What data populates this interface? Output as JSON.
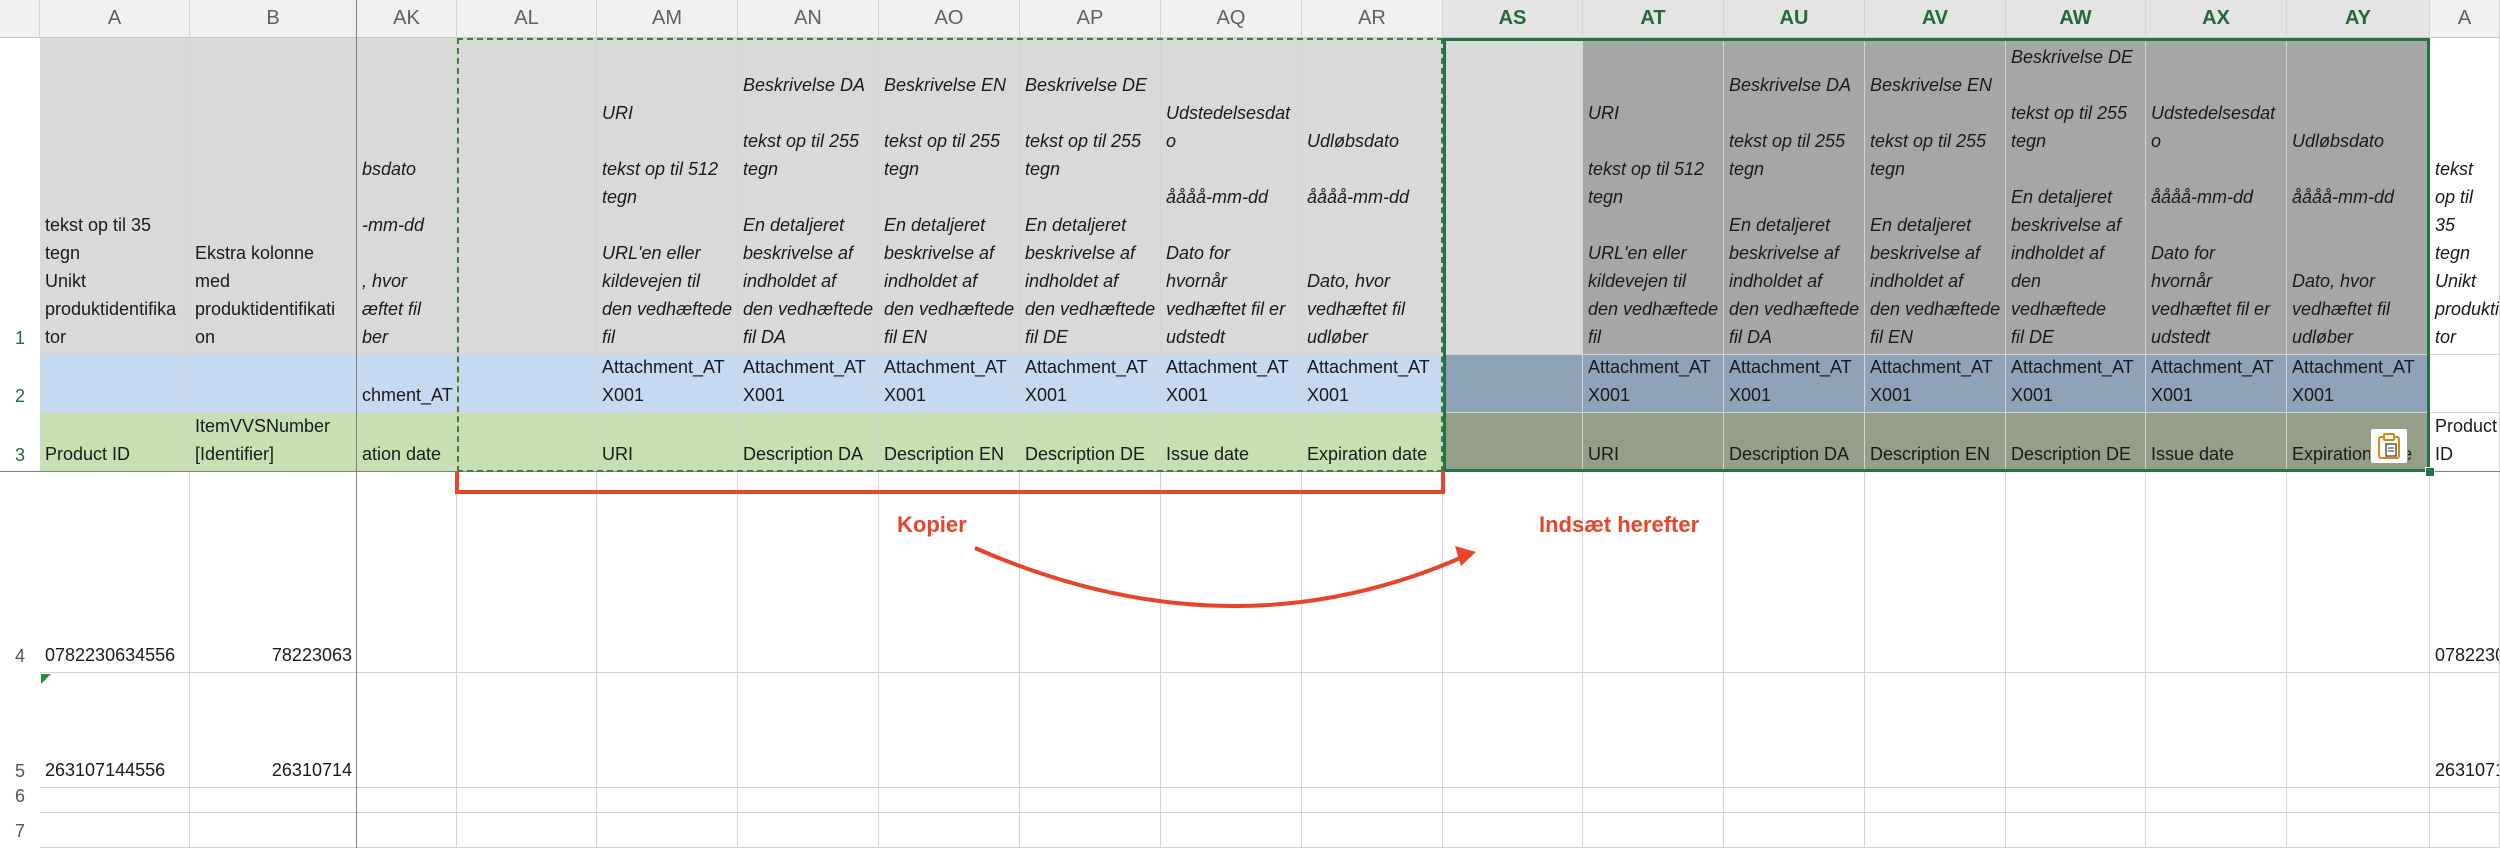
{
  "columns": [
    "A",
    "B",
    "AK",
    "AL",
    "AM",
    "AN",
    "AO",
    "AP",
    "AQ",
    "AR",
    "AS",
    "AT",
    "AU",
    "AV",
    "AW",
    "AX",
    "AY",
    "A"
  ],
  "selected_columns": [
    "AS",
    "AT",
    "AU",
    "AV",
    "AW",
    "AX",
    "AY"
  ],
  "rows": [
    "1",
    "2",
    "3",
    "4",
    "5",
    "6",
    "7"
  ],
  "selected_rows": [
    "1",
    "2",
    "3"
  ],
  "cells": {
    "A1": "tekst op til 35\ntegn\nUnikt\nproduktidentifika\ntor",
    "B1": "Ekstra kolonne med\nproduktidentifikati\non",
    "AK1": "bsdato\n\n-mm-dd\n\n, hvor\næftet fil\nber",
    "AM1": "URI\n\ntekst op til 512\ntegn\n\nURL'en eller\nkildevejen til\nden vedhæftede\nfil",
    "AN1": "Beskrivelse DA\n\ntekst op til 255\ntegn\n\nEn detaljeret\nbeskrivelse af\nindholdet af\nden vedhæftede\nfil DA",
    "AO1": "Beskrivelse EN\n\ntekst op til 255\ntegn\n\nEn detaljeret\nbeskrivelse af\nindholdet af\nden vedhæftede\nfil EN",
    "AP1": "Beskrivelse DE\n\ntekst op til 255\ntegn\n\nEn detaljeret\nbeskrivelse af\nindholdet af\nden vedhæftede\nfil DE",
    "AQ1": "Udstedelsesdat\no\n\nåååå-mm-dd\n\nDato for\nhvornår\nvedhæftet fil er\nudstedt",
    "AR1": "Udløbsdato\n\nåååå-mm-dd\n\n\nDato, hvor\nvedhæftet fil\nudløber",
    "AT1": "URI\n\ntekst op til 512\ntegn\n\nURL'en eller\nkildevejen til\nden vedhæftede\nfil",
    "AU1": "Beskrivelse DA\n\ntekst op til 255\ntegn\n\nEn detaljeret\nbeskrivelse af\nindholdet af\nden vedhæftede\nfil DA",
    "AV1": "Beskrivelse EN\n\ntekst op til 255\ntegn\n\nEn detaljeret\nbeskrivelse af\nindholdet af\nden vedhæftede\nfil EN",
    "AW1": "Beskrivelse DE\n\ntekst op til 255\ntegn\n\nEn detaljeret\nbeskrivelse af\nindholdet af\nden vedhæftede\nfil DE",
    "AX1": "Udstedelsesdat\no\n\nåååå-mm-dd\n\nDato for\nhvornår\nvedhæftet fil er\nudstedt",
    "AY1": "Udløbsdato\n\nåååå-mm-dd\n\n\nDato, hvor\nvedhæftet fil\nudløber",
    "AK2": "chment_AT",
    "AM2": "Attachment_AT\nX001",
    "AN2": "Attachment_AT\nX001",
    "AO2": "Attachment_AT\nX001",
    "AP2": "Attachment_AT\nX001",
    "AQ2": "Attachment_AT\nX001",
    "AR2": "Attachment_AT\nX001",
    "AT2": "Attachment_AT\nX001",
    "AU2": "Attachment_AT\nX001",
    "AV2": "Attachment_AT\nX001",
    "AW2": "Attachment_AT\nX001",
    "AX2": "Attachment_AT\nX001",
    "AY2": "Attachment_AT\nX001",
    "A3": "Product ID",
    "B3": "ItemVVSNumber\n[Identifier]",
    "AK3": "ation date",
    "AM3": "URI",
    "AN3": "Description DA",
    "AO3": "Description EN",
    "AP3": "Description DE",
    "AQ3": "Issue date",
    "AR3": "Expiration date",
    "AT3": "URI",
    "AU3": "Description DA",
    "AV3": "Description EN",
    "AW3": "Description DE",
    "AX3": "Issue date",
    "AY3": "Expiration date",
    "A4": "0782230634556",
    "B4": "78223063",
    "A5": "263107144556",
    "B5": "26310714"
  },
  "annotations": {
    "copy_label": "Kopier",
    "paste_label": "Indsæt herefter"
  },
  "colors": {
    "row1_fill": "#d9d9d9",
    "row1_selected_fill": "#a6a6a6",
    "row2_fill": "#c5d9f1",
    "row2_selected_fill": "#8ea2b8",
    "row3_fill": "#c6e0b4",
    "row3_selected_fill": "#959f88",
    "annotation": "#e8442a",
    "selection": "#217346"
  },
  "icons": {
    "paste_options": "clipboard-icon"
  }
}
